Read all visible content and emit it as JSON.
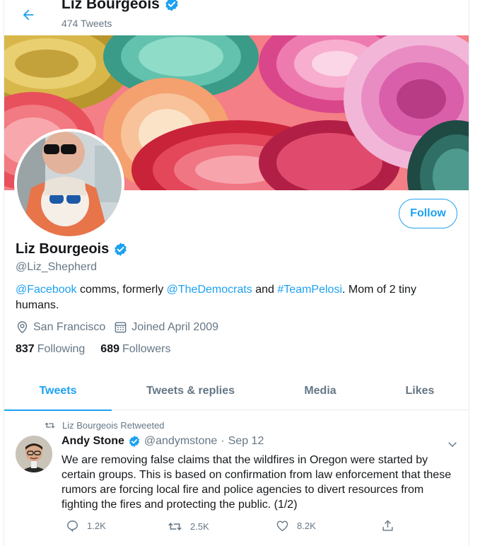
{
  "header": {
    "title": "Liz Bourgeois",
    "subtitle": "474 Tweets",
    "back_icon": "arrow-left-icon",
    "verified_icon": "verified-badge-icon"
  },
  "colors": {
    "accent": "#1da1f2",
    "secondary_text": "#657786",
    "primary_text": "#14171a",
    "border": "#e6ecf0"
  },
  "profile": {
    "name": "Liz Bourgeois",
    "handle": "@Liz_Shepherd",
    "follow_label": "Follow",
    "bio": {
      "mention1": "@Facebook",
      "text1": " comms, formerly ",
      "mention2": "@TheDemocrats",
      "text2": " and ",
      "hashtag": "#TeamPelosi",
      "text3": ". Mom of 2 tiny humans."
    },
    "location": "San Francisco",
    "location_icon": "location-pin-icon",
    "joined": "Joined April 2009",
    "joined_icon": "calendar-icon",
    "following_count": "837",
    "following_label": "Following",
    "followers_count": "689",
    "followers_label": "Followers"
  },
  "tabs": [
    {
      "label": "Tweets",
      "active": true
    },
    {
      "label": "Tweets & replies",
      "active": false
    },
    {
      "label": "Media",
      "active": false
    },
    {
      "label": "Likes",
      "active": false
    }
  ],
  "tweet": {
    "retweeted_by": "Liz Bourgeois Retweeted",
    "retweet_icon": "retweet-icon",
    "author_name": "Andy Stone",
    "author_handle": "@andymstone",
    "separator": "·",
    "date": "Sep 12",
    "text": "We are removing false claims that the wildfires in Oregon were started by certain groups. This is based on confirmation from law enforcement that these rumors are forcing local fire and police agencies to divert resources from fighting the fires and protecting the public. (1/2)",
    "replies": "1.2K",
    "retweets": "2.5K",
    "likes": "8.2K",
    "icons": {
      "reply": "reply-icon",
      "retweet": "retweet-icon",
      "like": "heart-icon",
      "share": "share-icon",
      "more": "chevron-down-icon"
    }
  }
}
